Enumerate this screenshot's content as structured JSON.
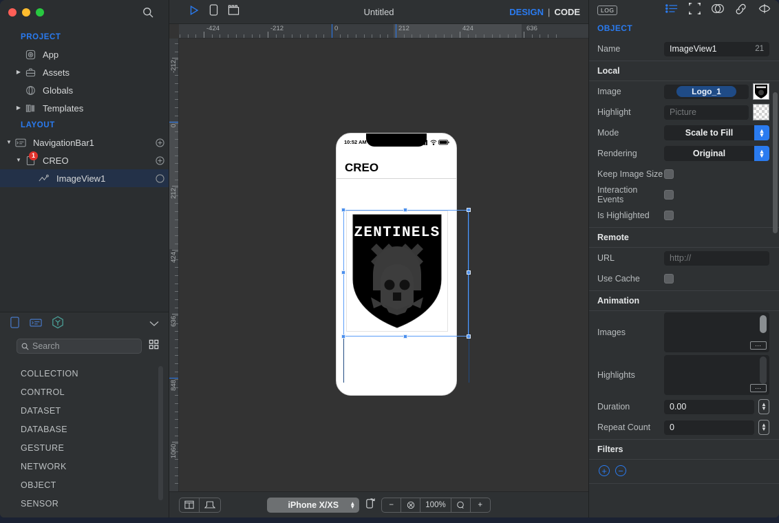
{
  "window": {
    "traffic_lights": [
      "close",
      "minimize",
      "maximize"
    ]
  },
  "sidebar": {
    "search_icon": "search-icon",
    "project_header": "PROJECT",
    "project_items": [
      {
        "label": "App",
        "icon": "app-icon",
        "disclosure": ""
      },
      {
        "label": "Assets",
        "icon": "assets-icon",
        "disclosure": "▶"
      },
      {
        "label": "Globals",
        "icon": "globals-icon",
        "disclosure": ""
      },
      {
        "label": "Templates",
        "icon": "templates-icon",
        "disclosure": "▶"
      }
    ],
    "layout_header": "LAYOUT",
    "layout_items": [
      {
        "label": "NavigationBar1",
        "icon": "navbar-icon",
        "disclosure": "▼",
        "right": "add-icon",
        "badge": "",
        "selected": false,
        "indent": 0
      },
      {
        "label": "CREO",
        "icon": "view-icon",
        "disclosure": "▼",
        "right": "add-icon",
        "badge": "1",
        "selected": false,
        "indent": 1
      },
      {
        "label": "ImageView1",
        "icon": "imageview-icon",
        "disclosure": "",
        "right": "circle-icon",
        "badge": "",
        "selected": true,
        "indent": 2
      }
    ]
  },
  "library": {
    "tabs": [
      {
        "name": "device-tab",
        "active": false
      },
      {
        "name": "navbar-tab",
        "active": false
      },
      {
        "name": "objects-tab",
        "active": true
      }
    ],
    "collapse_icon": "chevron-down-icon",
    "search_placeholder": "Search",
    "search_value": "",
    "grid_icon": "grid-view-icon",
    "categories": [
      "COLLECTION",
      "CONTROL",
      "DATASET",
      "DATABASE",
      "GESTURE",
      "NETWORK",
      "OBJECT",
      "SENSOR"
    ]
  },
  "toolbar": {
    "run_icon": "play-icon",
    "device_icon": "phone-icon",
    "snapshot_icon": "camera-icon",
    "title": "Untitled",
    "design_label": "DESIGN",
    "separator": "|",
    "code_label": "CODE"
  },
  "rulers": {
    "horizontal_labels": [
      "-424",
      "-212",
      "0",
      "212",
      "424",
      "636"
    ],
    "vertical_labels": [
      "-212",
      "0",
      "212",
      "424",
      "636",
      "848",
      "1060"
    ]
  },
  "phone": {
    "status_time": "10:52 AM",
    "status_signal": "signal-icon",
    "status_wifi": "wifi-icon",
    "status_battery": "battery-icon",
    "navbar_title": "CREO",
    "image_alt": "ZENTINELS",
    "logo_text": "ZENTINELS"
  },
  "bottom_toolbar": {
    "left_buttons": [
      {
        "name": "layout-columns-icon",
        "label": ""
      },
      {
        "name": "device-frame-icon",
        "label": ""
      }
    ],
    "device_name": "iPhone X/XS",
    "rotate_icon": "rotate-device-icon",
    "zoom_out": "−",
    "fit_icon": "fit-icon",
    "zoom_level": "100%",
    "actual_icon": "actual-size-icon",
    "zoom_in": "+"
  },
  "inspector": {
    "log_label": "LOG",
    "icons": [
      {
        "name": "properties-list-icon",
        "active": true
      },
      {
        "name": "layout-bounds-icon",
        "active": false
      },
      {
        "name": "appearance-icon",
        "active": false
      },
      {
        "name": "connections-icon",
        "active": false
      },
      {
        "name": "actions-icon",
        "active": false
      }
    ],
    "section_title": "OBJECT",
    "name_label": "Name",
    "name_value": "ImageView1",
    "name_index": "21",
    "groups": [
      {
        "title": "Local",
        "rows": [
          {
            "label": "Image",
            "type": "pill",
            "value": "Logo_1",
            "thumb": "logo-thumb"
          },
          {
            "label": "Highlight",
            "type": "text",
            "value": "",
            "placeholder": "Picture",
            "thumb": "empty-thumb"
          },
          {
            "label": "Mode",
            "type": "select",
            "value": "Scale to Fill"
          },
          {
            "label": "Rendering",
            "type": "select",
            "value": "Original"
          },
          {
            "label": "Keep Image Size",
            "type": "checkbox",
            "checked": false
          },
          {
            "label": "Interaction Events",
            "type": "checkbox",
            "checked": false
          },
          {
            "label": "Is Highlighted",
            "type": "checkbox",
            "checked": false
          }
        ]
      },
      {
        "title": "Remote",
        "rows": [
          {
            "label": "URL",
            "type": "text",
            "value": "",
            "placeholder": "http://"
          },
          {
            "label": "Use Cache",
            "type": "checkbox",
            "checked": false
          }
        ]
      },
      {
        "title": "Animation",
        "rows": [
          {
            "label": "Images",
            "type": "listbox",
            "value": ""
          },
          {
            "label": "Highlights",
            "type": "listbox",
            "value": ""
          },
          {
            "label": "Duration",
            "type": "stepper",
            "value": "0.00"
          },
          {
            "label": "Repeat Count",
            "type": "stepper",
            "value": "0"
          }
        ]
      },
      {
        "title": "Filters",
        "rows": [
          {
            "label": "",
            "type": "addremove",
            "add": "+",
            "remove": "−"
          }
        ]
      }
    ]
  },
  "colors": {
    "accent_blue": "#2a7bf0",
    "sidebar_bg": "#2b2e30",
    "panel_bg": "#2e3133",
    "canvas_bg": "#333333",
    "selection_blue": "#5a9cf8",
    "badge_red": "#e0322c",
    "teal": "#4a9e96"
  }
}
